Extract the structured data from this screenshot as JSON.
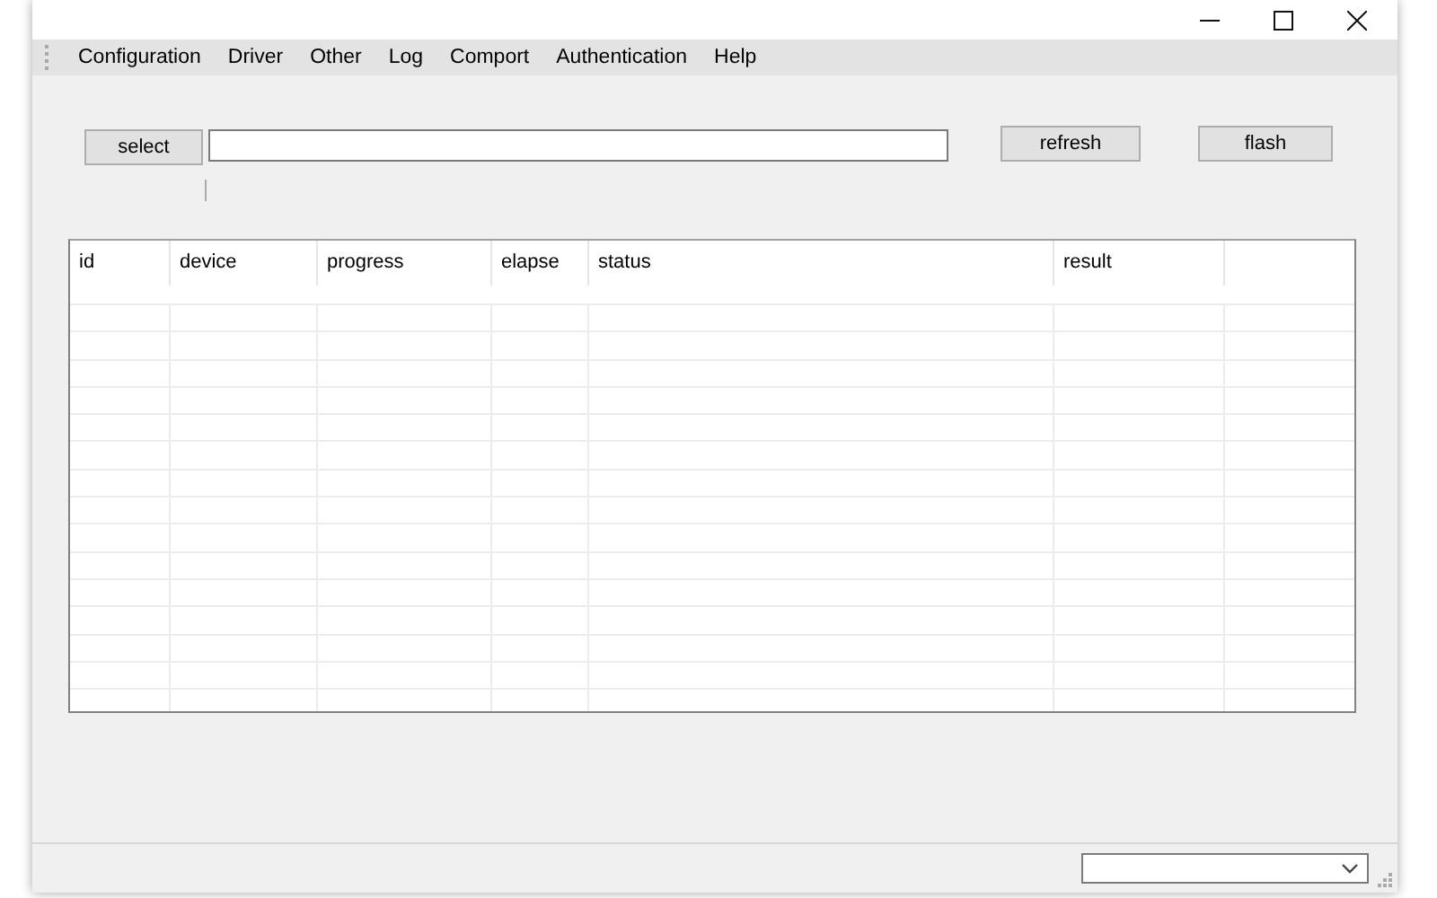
{
  "menu": [
    "Configuration",
    "Driver",
    "Other",
    "Log",
    "Comport",
    "Authentication",
    "Help"
  ],
  "toolbar": {
    "select_button": "select",
    "refresh_button": "refresh",
    "flash_button": "flash"
  },
  "table": {
    "columns": [
      "id",
      "device",
      "progress",
      "elapse",
      "status",
      "result"
    ]
  }
}
